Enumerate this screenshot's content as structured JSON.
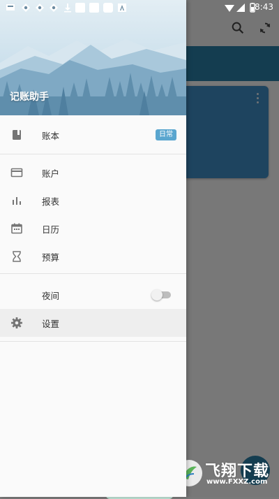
{
  "status_bar": {
    "time": "8:43",
    "left_icons": [
      "notification-icon",
      "app-icon",
      "app-icon",
      "app-icon",
      "download-icon",
      "app-icon",
      "app-icon",
      "app-icon",
      "text-icon"
    ],
    "right_icons": [
      "wifi-icon",
      "signal-icon",
      "battery-icon"
    ]
  },
  "drawer": {
    "app_title": "记账助手",
    "menu": [
      {
        "icon": "ledger-book-icon",
        "label": "账本",
        "badge": "日常"
      },
      {
        "icon": "card-icon",
        "label": "账户"
      },
      {
        "icon": "bar-chart-icon",
        "label": "报表"
      },
      {
        "icon": "calendar-icon",
        "label": "日历"
      },
      {
        "icon": "hourglass-icon",
        "label": "预算"
      },
      {
        "icon": "moon-icon",
        "label": "夜间",
        "toggle_on": false
      },
      {
        "icon": "gear-icon",
        "label": "设置"
      }
    ]
  },
  "background_app": {
    "toolbar_icons": [
      "search-icon",
      "sync-icon"
    ],
    "card_menu_icon": "more-vertical-icon",
    "primary_color": "#2a7fa7"
  },
  "watermark": {
    "brand": "飞翔下载",
    "url": "www.FXXZ.com"
  },
  "colors": {
    "badge": "#5aa6cf",
    "header_sky": "#cfe3ee",
    "header_mountains": "#6f9fbd"
  }
}
